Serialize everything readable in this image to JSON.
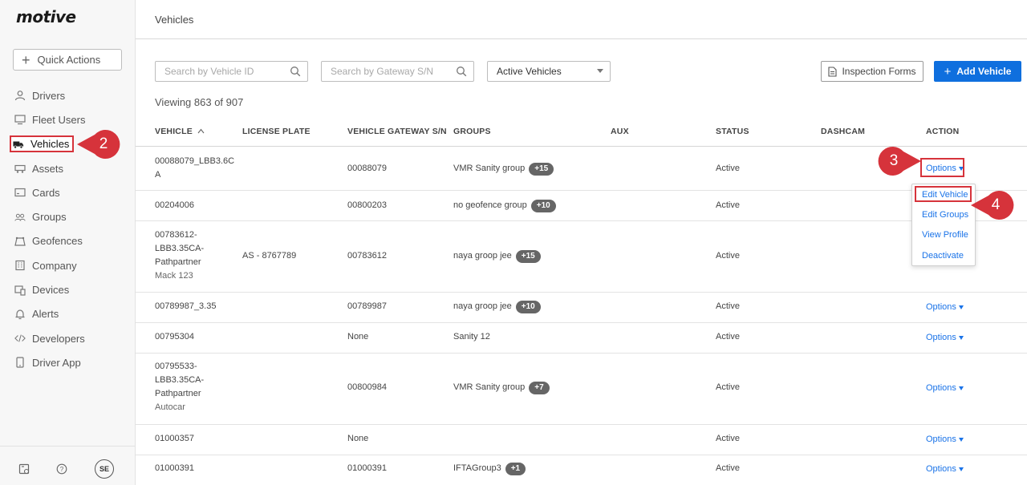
{
  "app": {
    "logo": "motive"
  },
  "sidebar": {
    "quick_actions": "Quick Actions",
    "items": [
      {
        "label": "Drivers",
        "icon": "person-icon"
      },
      {
        "label": "Fleet Users",
        "icon": "monitor-icon"
      },
      {
        "label": "Vehicles",
        "icon": "truck-icon",
        "active": true
      },
      {
        "label": "Assets",
        "icon": "trailer-icon"
      },
      {
        "label": "Cards",
        "icon": "card-icon"
      },
      {
        "label": "Groups",
        "icon": "groups-icon"
      },
      {
        "label": "Geofences",
        "icon": "geofence-icon"
      },
      {
        "label": "Company",
        "icon": "building-icon"
      },
      {
        "label": "Devices",
        "icon": "devices-icon"
      },
      {
        "label": "Alerts",
        "icon": "bell-icon"
      },
      {
        "label": "Developers",
        "icon": "code-icon"
      },
      {
        "label": "Driver App",
        "icon": "phone-icon"
      }
    ],
    "avatar": "SE"
  },
  "header": {
    "title": "Vehicles"
  },
  "toolbar": {
    "search_vehicle_placeholder": "Search by Vehicle ID",
    "search_gateway_placeholder": "Search by Gateway S/N",
    "status_filter": "Active Vehicles",
    "inspection_forms": "Inspection Forms",
    "add_vehicle": "Add Vehicle"
  },
  "viewing": "Viewing 863 of 907",
  "table": {
    "columns": [
      "VEHICLE",
      "LICENSE PLATE",
      "VEHICLE GATEWAY S/N",
      "GROUPS",
      "AUX",
      "STATUS",
      "DASHCAM",
      "ACTION"
    ],
    "sort_indicator": "^",
    "rows": [
      {
        "vehicle_lines": [
          "00088079_LBB3.6C",
          "A"
        ],
        "sub": "",
        "plate": "",
        "gateway": "00088079",
        "group": "VMR Sanity group",
        "badge": "+15",
        "status": "Active",
        "action": "Options"
      },
      {
        "vehicle_lines": [
          "00204006"
        ],
        "sub": "",
        "plate": "",
        "gateway": "00800203",
        "group": "no geofence group",
        "badge": "+10",
        "status": "Active",
        "action": ""
      },
      {
        "vehicle_lines": [
          "00783612-",
          "LBB3.35CA-",
          "Pathpartner"
        ],
        "sub": "Mack 123",
        "plate": "AS - 8767789",
        "gateway": "00783612",
        "group": "naya groop jee",
        "badge": "+15",
        "status": "Active",
        "action": ""
      },
      {
        "vehicle_lines": [
          "00789987_3.35"
        ],
        "sub": "",
        "plate": "",
        "gateway": "00789987",
        "group": "naya groop jee",
        "badge": "+10",
        "status": "Active",
        "action": "Options"
      },
      {
        "vehicle_lines": [
          "00795304"
        ],
        "sub": "",
        "plate": "",
        "gateway": "None",
        "group": "Sanity 12",
        "badge": "",
        "status": "Active",
        "action": "Options"
      },
      {
        "vehicle_lines": [
          "00795533-",
          "LBB3.35CA-",
          "Pathpartner"
        ],
        "sub": "Autocar",
        "plate": "",
        "gateway": "00800984",
        "group": "VMR Sanity group",
        "badge": "+7",
        "status": "Active",
        "action": "Options"
      },
      {
        "vehicle_lines": [
          "01000357"
        ],
        "sub": "",
        "plate": "",
        "gateway": "None",
        "group": "",
        "badge": "",
        "status": "Active",
        "action": "Options"
      },
      {
        "vehicle_lines": [
          "01000391"
        ],
        "sub": "",
        "plate": "",
        "gateway": "01000391",
        "group": "IFTAGroup3",
        "badge": "+1",
        "status": "Active",
        "action": "Options"
      }
    ]
  },
  "dropdown": {
    "items": [
      "Edit Vehicle",
      "Edit Groups",
      "View Profile",
      "Deactivate"
    ]
  },
  "callouts": {
    "step2": "2",
    "step3": "3",
    "step4": "4"
  },
  "colors": {
    "accent": "#0f6fde",
    "link": "#1a73e8",
    "callout": "#d6333b"
  }
}
